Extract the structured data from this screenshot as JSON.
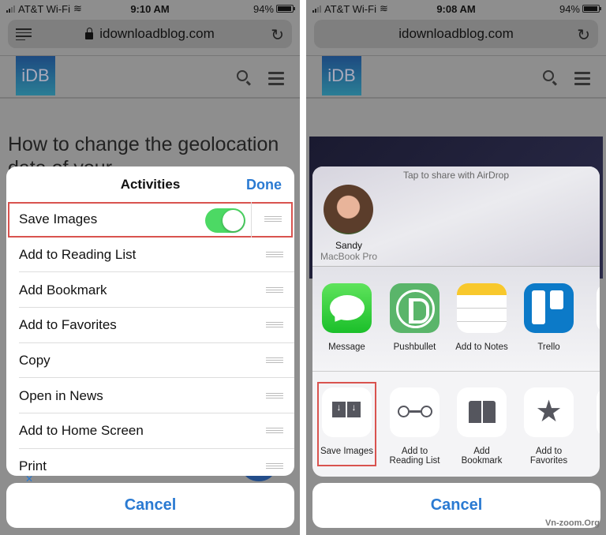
{
  "left": {
    "status": {
      "carrier": "AT&T Wi-Fi",
      "time": "9:10 AM",
      "battery": "94%"
    },
    "url": "idownloadblog.com",
    "logo": "iDB",
    "headline": "How to change the geolocation data of your",
    "sheet": {
      "title": "Activities",
      "done": "Done",
      "items": [
        {
          "label": "Save Images",
          "toggle_on": true,
          "highlighted": true
        },
        {
          "label": "Add to Reading List"
        },
        {
          "label": "Add Bookmark"
        },
        {
          "label": "Add to Favorites"
        },
        {
          "label": "Copy"
        },
        {
          "label": "Open in News"
        },
        {
          "label": "Add to Home Screen"
        },
        {
          "label": "Print"
        }
      ]
    },
    "cancel": "Cancel"
  },
  "right": {
    "status": {
      "carrier": "AT&T Wi-Fi",
      "time": "9:08 AM",
      "battery": "94%"
    },
    "url": "idownloadblog.com",
    "logo": "iDB",
    "airdrop": {
      "title": "Tap to share with AirDrop",
      "peer_name": "Sandy",
      "peer_device": "MacBook Pro"
    },
    "apps": [
      {
        "label": "Message",
        "icon": "messages-icon"
      },
      {
        "label": "Pushbullet",
        "icon": "pushbullet-icon"
      },
      {
        "label": "Add to Notes",
        "icon": "notes-icon"
      },
      {
        "label": "Trello",
        "icon": "trello-icon"
      }
    ],
    "actions": [
      {
        "label": "Save Images",
        "icon": "save-images-icon",
        "highlighted": true
      },
      {
        "label": "Add to\nReading List",
        "icon": "glasses-icon"
      },
      {
        "label": "Add\nBookmark",
        "icon": "book-icon"
      },
      {
        "label": "Add to\nFavorites",
        "icon": "star-icon"
      }
    ],
    "cancel": "Cancel",
    "watermark": "Vn-zoom.Org"
  },
  "colors": {
    "accent": "#2a7ad2",
    "toggle_on": "#4cd964",
    "highlight": "#d9534f"
  }
}
